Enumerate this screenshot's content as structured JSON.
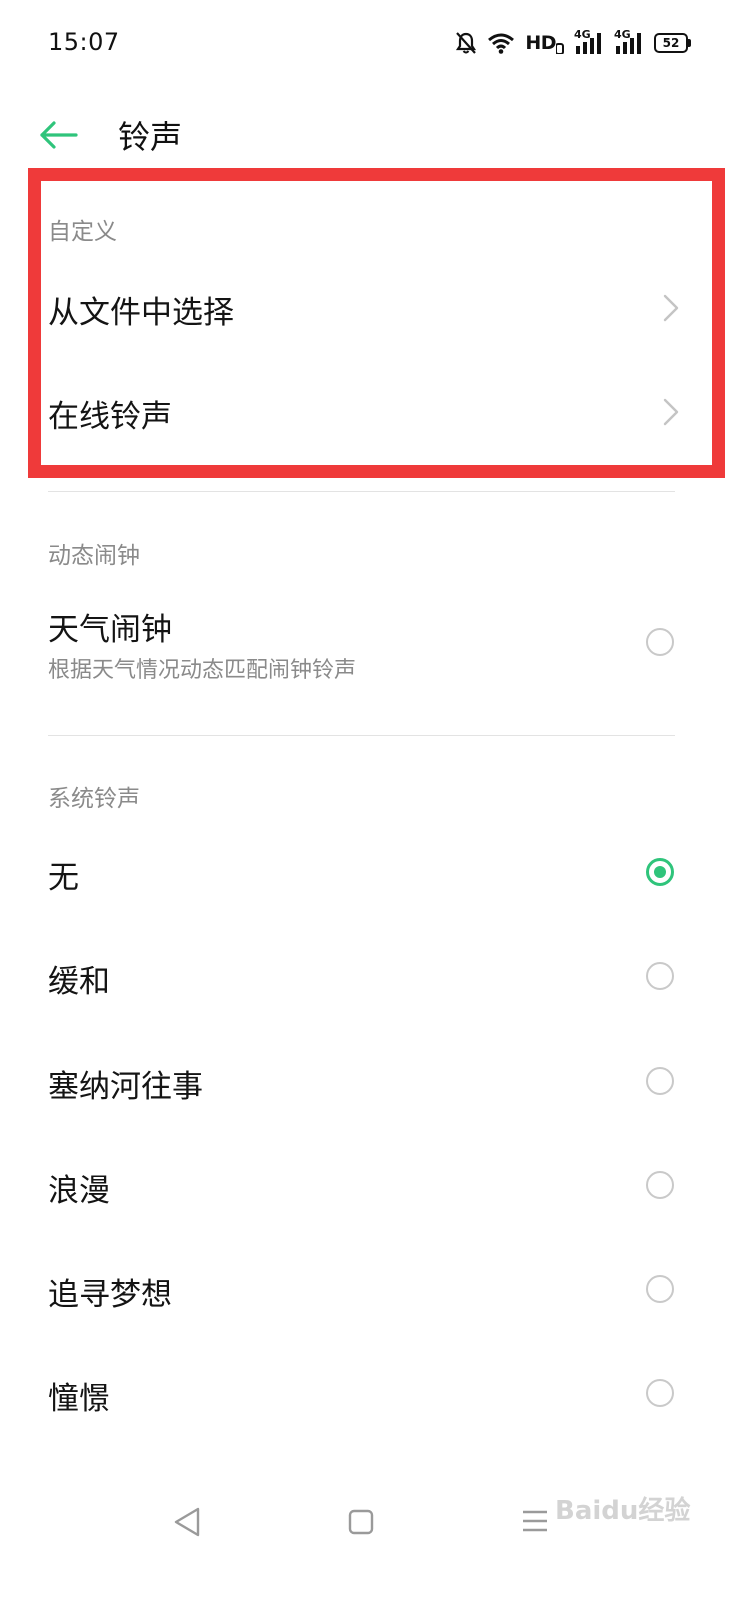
{
  "status_bar": {
    "time": "15:07",
    "network_label": "HD",
    "signal_1_label": "4G",
    "signal_2_label": "4G",
    "battery": "52"
  },
  "header": {
    "title": "铃声"
  },
  "custom_section": {
    "label": "自定义",
    "items": [
      {
        "label": "从文件中选择"
      },
      {
        "label": "在线铃声"
      }
    ]
  },
  "dynamic_section": {
    "label": "动态闹钟",
    "item": {
      "label": "天气闹钟",
      "subtitle": "根据天气情况动态匹配闹钟铃声",
      "selected": false
    }
  },
  "system_section": {
    "label": "系统铃声",
    "items": [
      {
        "label": "无",
        "selected": true
      },
      {
        "label": "缓和",
        "selected": false
      },
      {
        "label": "塞纳河往事",
        "selected": false
      },
      {
        "label": "浪漫",
        "selected": false
      },
      {
        "label": "追寻梦想",
        "selected": false
      },
      {
        "label": "憧憬",
        "selected": false
      }
    ]
  },
  "watermark": "Baidu经验",
  "colors": {
    "accent": "#2fc47b",
    "highlight": "#ef3a3a"
  }
}
